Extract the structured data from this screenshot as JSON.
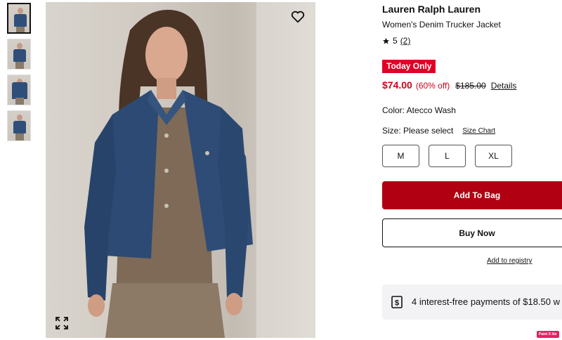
{
  "gallery": {
    "thumbnails": [
      "thumb-1",
      "thumb-2",
      "thumb-3",
      "thumb-4"
    ],
    "selected_index": 0,
    "wishlist_icon": "heart-outline-icon",
    "expand_icon": "expand-icon"
  },
  "product": {
    "brand": "Lauren Ralph Lauren",
    "name": "Women's Denim Trucker Jacket",
    "rating_icon": "star-icon",
    "rating": "5",
    "review_count": "(2)",
    "badge": "Today Only",
    "sale_price": "$74.00",
    "discount": "(60% off)",
    "original_price": "$185.00",
    "details_link": "Details",
    "color_label": "Color: Atecco Wash",
    "size_label": "Size: Please select",
    "size_chart_link": "Size Chart",
    "sizes": [
      "M",
      "L",
      "XL"
    ]
  },
  "actions": {
    "add_to_bag": "Add To Bag",
    "buy_now": "Buy Now",
    "registry": "Add to registry"
  },
  "installments": {
    "icon": "dollar-card-icon",
    "text": "4 interest-free payments of $18.50 w"
  },
  "overlay_badge": "Paint X lite",
  "colors": {
    "sale_red": "#d0021b",
    "badge_red": "#e00027",
    "bag_button": "#b00012",
    "installment_bg": "#f3f3f5"
  }
}
